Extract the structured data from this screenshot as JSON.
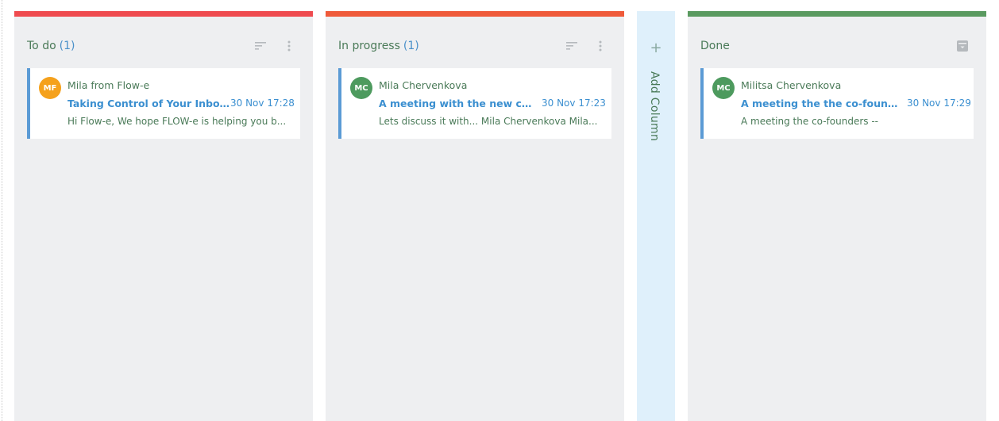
{
  "board": {
    "columns": [
      {
        "title": "To do",
        "count": "(1)",
        "bar_color": "#ef4b4f",
        "icons": [
          "sort-icon",
          "more-vertical-icon"
        ],
        "card": {
          "avatar_initials": "MF",
          "avatar_color": "#f5a11c",
          "sender": "Mila from Flow-e",
          "subject": "Taking Control of Your Inbox? ...",
          "date": "30 Nov 17:28",
          "preview": "Hi Flow-e, We hope FLOW-e is helping you b..."
        }
      },
      {
        "title": "In progress",
        "count": "(1)",
        "bar_color": "#ef5a3a",
        "icons": [
          "sort-icon",
          "more-vertical-icon"
        ],
        "card": {
          "avatar_initials": "MC",
          "avatar_color": "#4d9a5e",
          "sender": "Mila Chervenkova",
          "subject": "A meeting with the new candi...",
          "date": "30 Nov 17:23",
          "preview": "Lets discuss it with... Mila Chervenkova Mila..."
        }
      },
      {
        "title": "Done",
        "count": "",
        "bar_color": "#5a9a60",
        "icons": [
          "archive-icon"
        ],
        "card": {
          "avatar_initials": "MC",
          "avatar_color": "#4d9a5e",
          "sender": "Militsa Chervenkova",
          "subject": "A meeting the the co-founders",
          "date": "30 Nov 17:29",
          "preview": "A meeting the co-founders --"
        }
      }
    ],
    "add_column": {
      "plus": "+",
      "label": "Add Column"
    }
  },
  "colors": {
    "column_bg": "#eeeff1",
    "card_border": "#5b9bd5",
    "text_green": "#4a7a58",
    "text_blue": "#3b8fd0",
    "add_column_bg": "#dff0fb"
  }
}
